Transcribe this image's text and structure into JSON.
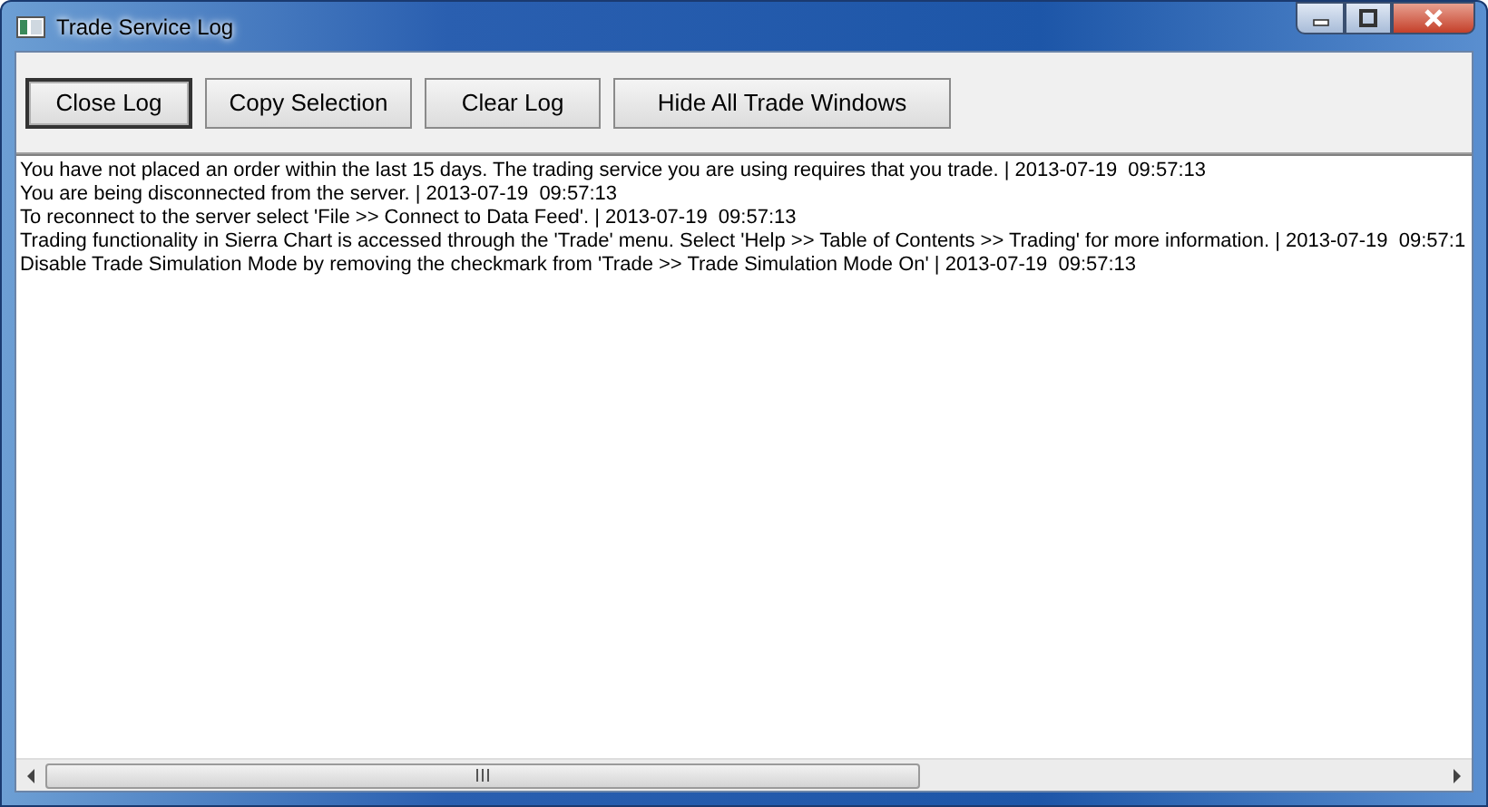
{
  "window": {
    "title": "Trade Service Log"
  },
  "buttons": [
    {
      "label": "Close Log",
      "default": true
    },
    {
      "label": "Copy Selection",
      "default": false
    },
    {
      "label": "Clear Log",
      "default": false
    },
    {
      "label": "Hide All Trade Windows",
      "default": false
    }
  ],
  "log_lines": [
    "You have not placed an order within the last 15 days. The trading service you are using requires that you trade. | 2013-07-19  09:57:13",
    "You are being disconnected from the server. | 2013-07-19  09:57:13",
    "To reconnect to the server select 'File >> Connect to Data Feed'. | 2013-07-19  09:57:13",
    "Trading functionality in Sierra Chart is accessed through the 'Trade' menu. Select 'Help >> Table of Contents >> Trading' for more information. | 2013-07-19  09:57:1",
    "Disable Trade Simulation Mode by removing the checkmark from 'Trade >> Trade Simulation Mode On' | 2013-07-19  09:57:13"
  ]
}
